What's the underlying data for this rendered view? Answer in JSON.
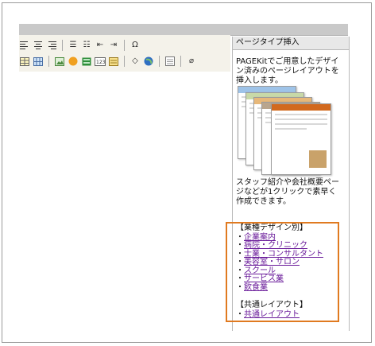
{
  "panel": {
    "title": "ページタイプ挿入",
    "intro": "PAGEKitでご用意したデザイン済みのページレイアウトを挿入します。",
    "note": "スタッフ紹介や会社概要ページなどが1クリックで素早く作成できます。"
  },
  "categories": {
    "industry_heading": "【業種デザイン別】",
    "industry_items": [
      "企業案内",
      "病院・クリニック",
      "士業・コンサルタント",
      "美容室・サロン",
      "スクール",
      "サービス業",
      "飲食業"
    ],
    "common_heading": "【共通レイアウト】",
    "common_items": [
      "共通レイアウト"
    ],
    "bullet": "・"
  },
  "toolbar": {
    "row1": [
      "align-left-icon",
      "align-center-icon",
      "align-right-icon",
      "ordered-list-icon",
      "unordered-list-icon",
      "outdent-icon",
      "indent-icon",
      "special-char-icon"
    ],
    "row2": [
      "table-icon",
      "image-icon",
      "flash-icon",
      "media-icon",
      "form-icon",
      "template-icon",
      "source-icon",
      "globe-icon",
      "layout-icon",
      "eraser-icon"
    ]
  },
  "colors": {
    "highlight": "#e07a20",
    "link": "#6a1b9a"
  }
}
